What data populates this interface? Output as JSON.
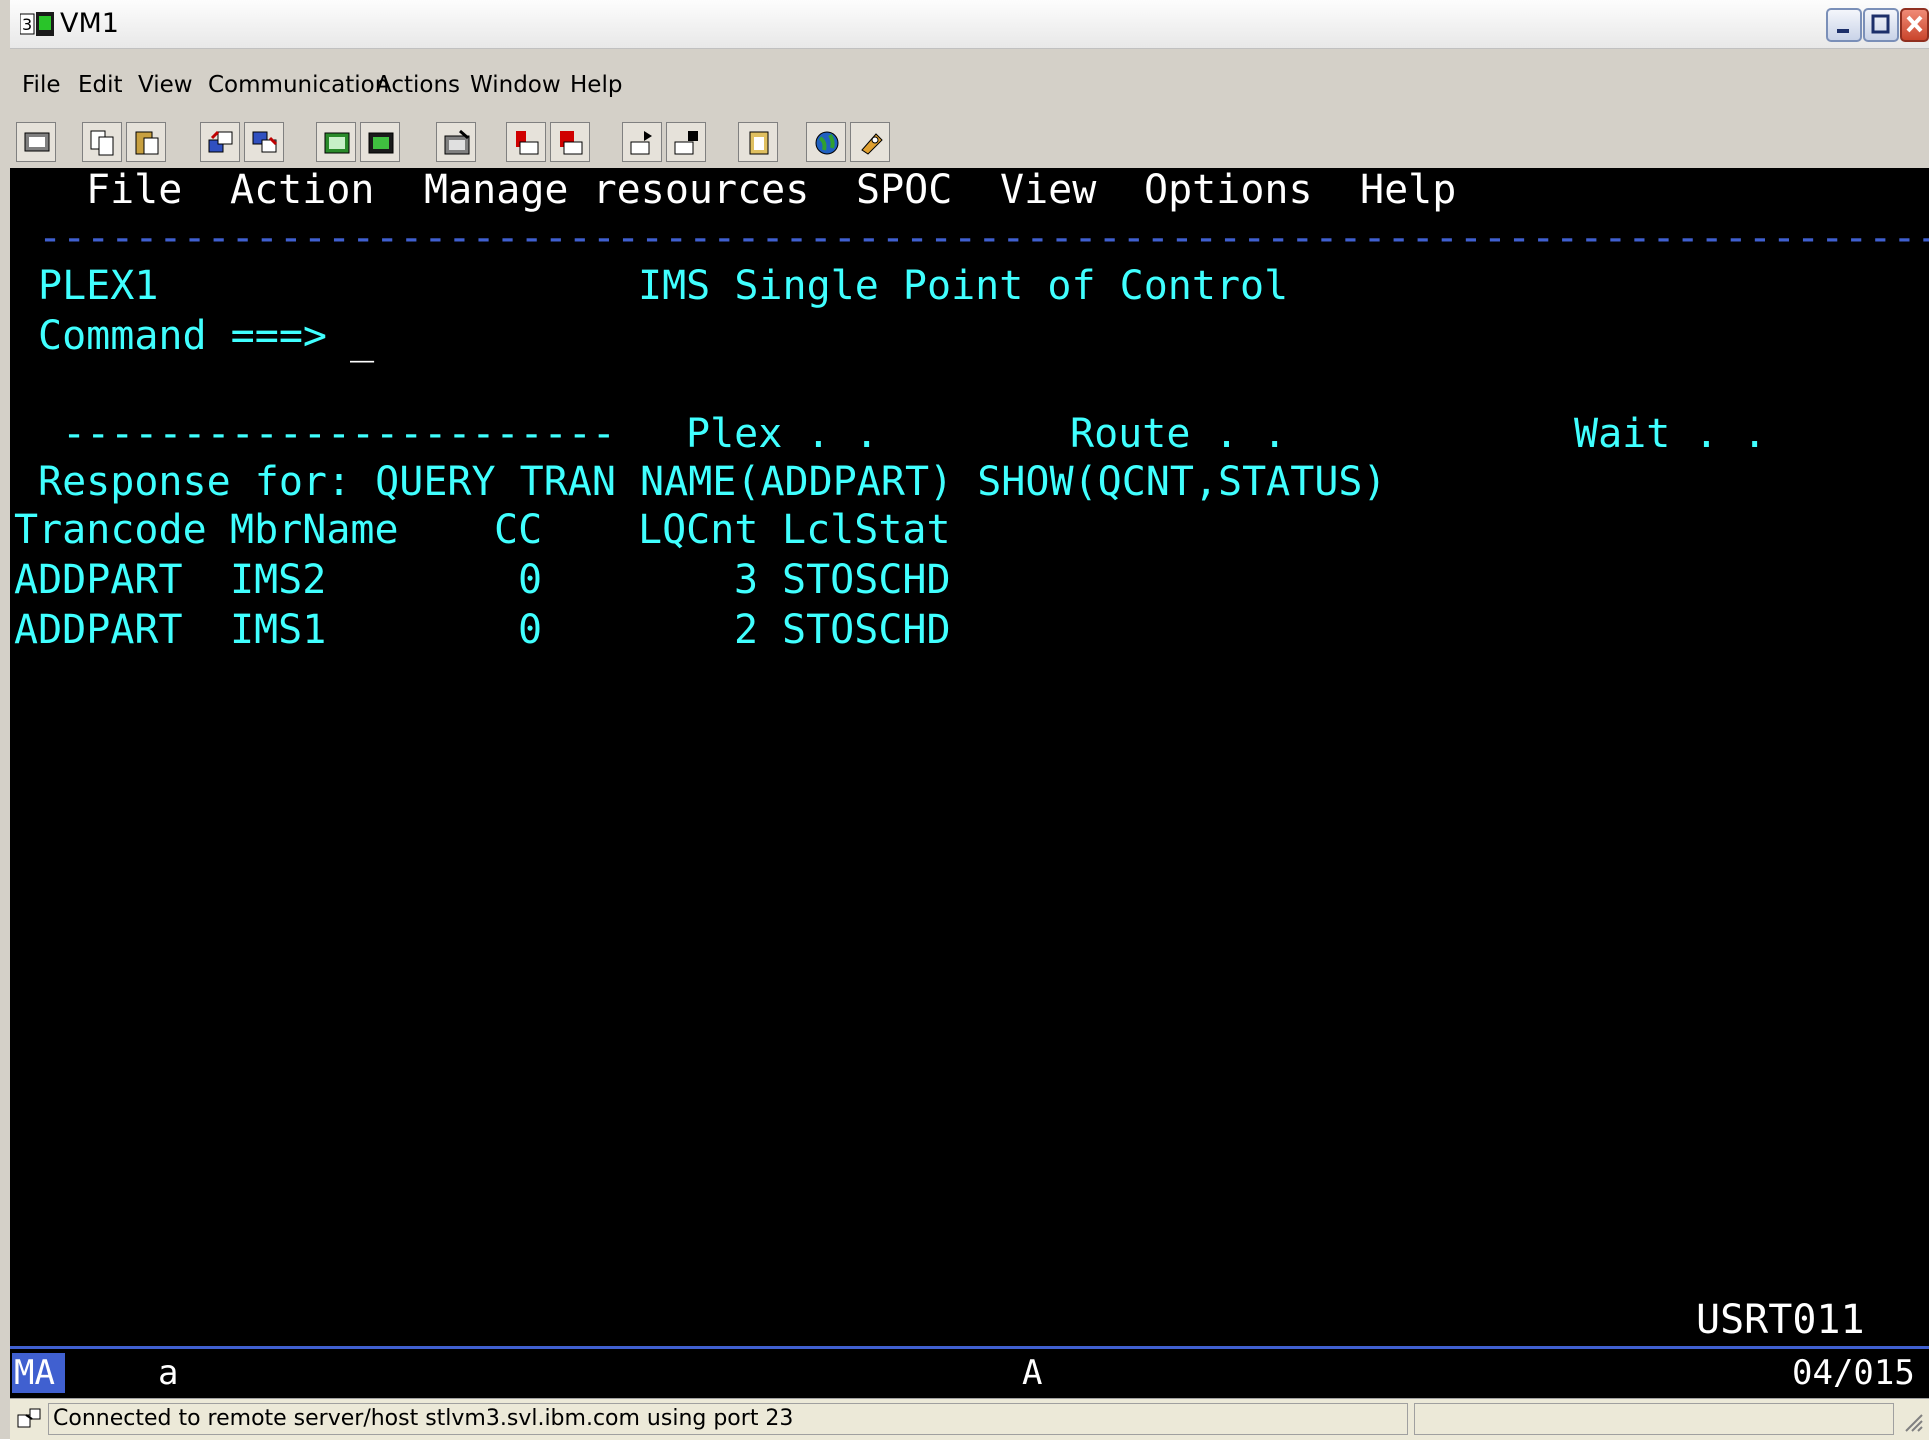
{
  "window": {
    "title": "VM1"
  },
  "menubar": {
    "items": [
      "File",
      "Edit",
      "View",
      "Communication",
      "Actions",
      "Window",
      "Help"
    ]
  },
  "toolbar": {
    "buttons": [
      "display-icon",
      "copy-icon",
      "paste-icon",
      "send-icon",
      "receive-icon",
      "keypad-icon",
      "keypad2-icon",
      "macro-icon",
      "record-icon",
      "stop-icon",
      "play-icon",
      "play2-icon",
      "clipboard-icon",
      "globe-icon",
      "key-icon"
    ]
  },
  "terminal": {
    "action_bar": [
      "File",
      "Action",
      "Manage resources",
      "SPOC",
      "View",
      "Options",
      "Help"
    ],
    "separator": "--------------------------------------------------------------------------------",
    "plex": "PLEX1",
    "panel_title": "IMS Single Point of Control",
    "command_label": "Command ===>",
    "cursor": "_",
    "field_dashes": "-----------------------",
    "plex_label": "Plex . .",
    "route_label": "Route . .",
    "wait_label": "Wait . .",
    "response": "Response for: QUERY TRAN NAME(ADDPART) SHOW(QCNT,STATUS)",
    "columns": [
      "Trancode",
      "MbrName",
      "CC",
      "LQCnt",
      "LclStat"
    ],
    "rows": [
      [
        "ADDPART",
        "IMS2",
        "0",
        "3",
        "STOSCHD"
      ],
      [
        "ADDPART",
        "IMS1",
        "0",
        "2",
        "STOSCHD"
      ]
    ],
    "userid": "USRT011"
  },
  "oia": {
    "mode": "MA",
    "session": "a",
    "field": "A",
    "cursor_pos": "04/015"
  },
  "statusbar": {
    "text": "Connected to remote server/host stlvm3.svl.ibm.com using port 23"
  },
  "colors": {
    "screen_bg": "#000000",
    "screen_text": "#40ffff",
    "emphasis_text": "#ffffff",
    "oia_accent": "#4060d0"
  }
}
